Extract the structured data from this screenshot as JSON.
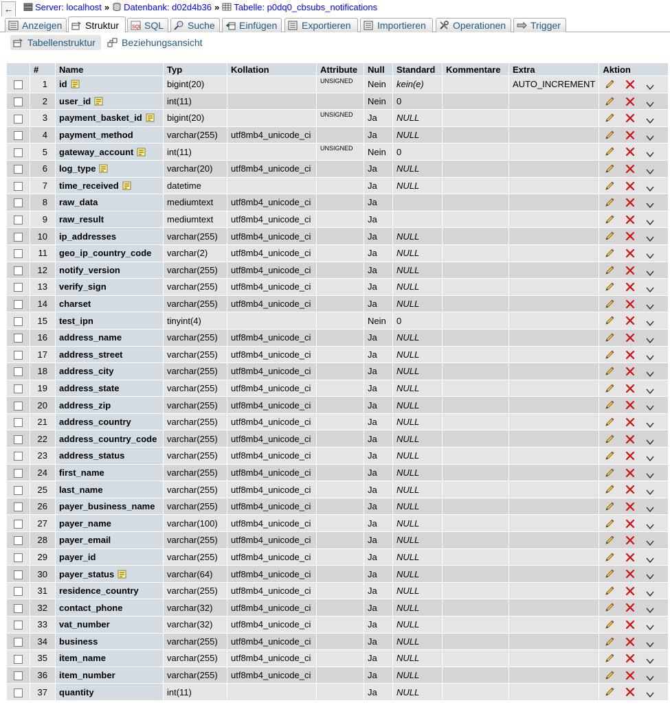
{
  "breadcrumb": {
    "server_label": "Server: localhost",
    "database_label": "Datenbank: d02d4b36",
    "table_label": "Tabelle: p0dq0_cbsubs_notifications",
    "separator": "»"
  },
  "back_symbol": "←",
  "tabs": [
    {
      "label": "Anzeigen",
      "icon": "browse-icon",
      "active": false
    },
    {
      "label": "Struktur",
      "icon": "structure-icon",
      "active": true
    },
    {
      "label": "SQL",
      "icon": "sql-icon",
      "active": false
    },
    {
      "label": "Suche",
      "icon": "search-icon",
      "active": false
    },
    {
      "label": "Einfügen",
      "icon": "insert-icon",
      "active": false
    },
    {
      "label": "Exportieren",
      "icon": "export-icon",
      "active": false
    },
    {
      "label": "Importieren",
      "icon": "import-icon",
      "active": false
    },
    {
      "label": "Operationen",
      "icon": "operations-icon",
      "active": false
    },
    {
      "label": "Trigger",
      "icon": "trigger-icon",
      "active": false
    }
  ],
  "subtabs": [
    {
      "label": "Tabellenstruktur",
      "icon": "table-structure-icon",
      "active": true
    },
    {
      "label": "Beziehungsansicht",
      "icon": "relation-view-icon",
      "active": false
    }
  ],
  "columns": [
    "#",
    "Name",
    "Typ",
    "Kollation",
    "Attribute",
    "Null",
    "Standard",
    "Kommentare",
    "Extra",
    "Aktion"
  ],
  "rows": [
    {
      "n": "1",
      "name": "id",
      "key": true,
      "type": "bigint(20)",
      "coll": "",
      "attr": "UNSIGNED",
      "null": "Nein",
      "def": "kein(e)",
      "defItalic": true,
      "extra": "AUTO_INCREMENT"
    },
    {
      "n": "2",
      "name": "user_id",
      "key": true,
      "type": "int(11)",
      "coll": "",
      "attr": "",
      "null": "Nein",
      "def": "0",
      "defItalic": false,
      "extra": ""
    },
    {
      "n": "3",
      "name": "payment_basket_id",
      "key": true,
      "type": "bigint(20)",
      "coll": "",
      "attr": "UNSIGNED",
      "null": "Ja",
      "def": "NULL",
      "defItalic": true,
      "extra": ""
    },
    {
      "n": "4",
      "name": "payment_method",
      "key": false,
      "type": "varchar(255)",
      "coll": "utf8mb4_unicode_ci",
      "attr": "",
      "null": "Ja",
      "def": "NULL",
      "defItalic": true,
      "extra": ""
    },
    {
      "n": "5",
      "name": "gateway_account",
      "key": true,
      "type": "int(11)",
      "coll": "",
      "attr": "UNSIGNED",
      "null": "Nein",
      "def": "0",
      "defItalic": false,
      "extra": ""
    },
    {
      "n": "6",
      "name": "log_type",
      "key": true,
      "type": "varchar(20)",
      "coll": "utf8mb4_unicode_ci",
      "attr": "",
      "null": "Ja",
      "def": "NULL",
      "defItalic": true,
      "extra": ""
    },
    {
      "n": "7",
      "name": "time_received",
      "key": true,
      "type": "datetime",
      "coll": "",
      "attr": "",
      "null": "Ja",
      "def": "NULL",
      "defItalic": true,
      "extra": ""
    },
    {
      "n": "8",
      "name": "raw_data",
      "key": false,
      "type": "mediumtext",
      "coll": "utf8mb4_unicode_ci",
      "attr": "",
      "null": "Ja",
      "def": "",
      "defItalic": false,
      "extra": ""
    },
    {
      "n": "9",
      "name": "raw_result",
      "key": false,
      "type": "mediumtext",
      "coll": "utf8mb4_unicode_ci",
      "attr": "",
      "null": "Ja",
      "def": "",
      "defItalic": false,
      "extra": ""
    },
    {
      "n": "10",
      "name": "ip_addresses",
      "key": false,
      "type": "varchar(255)",
      "coll": "utf8mb4_unicode_ci",
      "attr": "",
      "null": "Ja",
      "def": "NULL",
      "defItalic": true,
      "extra": ""
    },
    {
      "n": "11",
      "name": "geo_ip_country_code",
      "key": false,
      "type": "varchar(2)",
      "coll": "utf8mb4_unicode_ci",
      "attr": "",
      "null": "Ja",
      "def": "NULL",
      "defItalic": true,
      "extra": ""
    },
    {
      "n": "12",
      "name": "notify_version",
      "key": false,
      "type": "varchar(255)",
      "coll": "utf8mb4_unicode_ci",
      "attr": "",
      "null": "Ja",
      "def": "NULL",
      "defItalic": true,
      "extra": ""
    },
    {
      "n": "13",
      "name": "verify_sign",
      "key": false,
      "type": "varchar(255)",
      "coll": "utf8mb4_unicode_ci",
      "attr": "",
      "null": "Ja",
      "def": "NULL",
      "defItalic": true,
      "extra": ""
    },
    {
      "n": "14",
      "name": "charset",
      "key": false,
      "type": "varchar(255)",
      "coll": "utf8mb4_unicode_ci",
      "attr": "",
      "null": "Ja",
      "def": "NULL",
      "defItalic": true,
      "extra": ""
    },
    {
      "n": "15",
      "name": "test_ipn",
      "key": false,
      "type": "tinyint(4)",
      "coll": "",
      "attr": "",
      "null": "Nein",
      "def": "0",
      "defItalic": false,
      "extra": ""
    },
    {
      "n": "16",
      "name": "address_name",
      "key": false,
      "type": "varchar(255)",
      "coll": "utf8mb4_unicode_ci",
      "attr": "",
      "null": "Ja",
      "def": "NULL",
      "defItalic": true,
      "extra": ""
    },
    {
      "n": "17",
      "name": "address_street",
      "key": false,
      "type": "varchar(255)",
      "coll": "utf8mb4_unicode_ci",
      "attr": "",
      "null": "Ja",
      "def": "NULL",
      "defItalic": true,
      "extra": ""
    },
    {
      "n": "18",
      "name": "address_city",
      "key": false,
      "type": "varchar(255)",
      "coll": "utf8mb4_unicode_ci",
      "attr": "",
      "null": "Ja",
      "def": "NULL",
      "defItalic": true,
      "extra": ""
    },
    {
      "n": "19",
      "name": "address_state",
      "key": false,
      "type": "varchar(255)",
      "coll": "utf8mb4_unicode_ci",
      "attr": "",
      "null": "Ja",
      "def": "NULL",
      "defItalic": true,
      "extra": ""
    },
    {
      "n": "20",
      "name": "address_zip",
      "key": false,
      "type": "varchar(255)",
      "coll": "utf8mb4_unicode_ci",
      "attr": "",
      "null": "Ja",
      "def": "NULL",
      "defItalic": true,
      "extra": ""
    },
    {
      "n": "21",
      "name": "address_country",
      "key": false,
      "type": "varchar(255)",
      "coll": "utf8mb4_unicode_ci",
      "attr": "",
      "null": "Ja",
      "def": "NULL",
      "defItalic": true,
      "extra": ""
    },
    {
      "n": "22",
      "name": "address_country_code",
      "key": false,
      "type": "varchar(255)",
      "coll": "utf8mb4_unicode_ci",
      "attr": "",
      "null": "Ja",
      "def": "NULL",
      "defItalic": true,
      "extra": ""
    },
    {
      "n": "23",
      "name": "address_status",
      "key": false,
      "type": "varchar(255)",
      "coll": "utf8mb4_unicode_ci",
      "attr": "",
      "null": "Ja",
      "def": "NULL",
      "defItalic": true,
      "extra": ""
    },
    {
      "n": "24",
      "name": "first_name",
      "key": false,
      "type": "varchar(255)",
      "coll": "utf8mb4_unicode_ci",
      "attr": "",
      "null": "Ja",
      "def": "NULL",
      "defItalic": true,
      "extra": ""
    },
    {
      "n": "25",
      "name": "last_name",
      "key": false,
      "type": "varchar(255)",
      "coll": "utf8mb4_unicode_ci",
      "attr": "",
      "null": "Ja",
      "def": "NULL",
      "defItalic": true,
      "extra": ""
    },
    {
      "n": "26",
      "name": "payer_business_name",
      "key": false,
      "type": "varchar(255)",
      "coll": "utf8mb4_unicode_ci",
      "attr": "",
      "null": "Ja",
      "def": "NULL",
      "defItalic": true,
      "extra": ""
    },
    {
      "n": "27",
      "name": "payer_name",
      "key": false,
      "type": "varchar(100)",
      "coll": "utf8mb4_unicode_ci",
      "attr": "",
      "null": "Ja",
      "def": "NULL",
      "defItalic": true,
      "extra": ""
    },
    {
      "n": "28",
      "name": "payer_email",
      "key": false,
      "type": "varchar(255)",
      "coll": "utf8mb4_unicode_ci",
      "attr": "",
      "null": "Ja",
      "def": "NULL",
      "defItalic": true,
      "extra": ""
    },
    {
      "n": "29",
      "name": "payer_id",
      "key": false,
      "type": "varchar(255)",
      "coll": "utf8mb4_unicode_ci",
      "attr": "",
      "null": "Ja",
      "def": "NULL",
      "defItalic": true,
      "extra": ""
    },
    {
      "n": "30",
      "name": "payer_status",
      "key": true,
      "type": "varchar(64)",
      "coll": "utf8mb4_unicode_ci",
      "attr": "",
      "null": "Ja",
      "def": "NULL",
      "defItalic": true,
      "extra": ""
    },
    {
      "n": "31",
      "name": "residence_country",
      "key": false,
      "type": "varchar(255)",
      "coll": "utf8mb4_unicode_ci",
      "attr": "",
      "null": "Ja",
      "def": "NULL",
      "defItalic": true,
      "extra": ""
    },
    {
      "n": "32",
      "name": "contact_phone",
      "key": false,
      "type": "varchar(32)",
      "coll": "utf8mb4_unicode_ci",
      "attr": "",
      "null": "Ja",
      "def": "NULL",
      "defItalic": true,
      "extra": ""
    },
    {
      "n": "33",
      "name": "vat_number",
      "key": false,
      "type": "varchar(32)",
      "coll": "utf8mb4_unicode_ci",
      "attr": "",
      "null": "Ja",
      "def": "NULL",
      "defItalic": true,
      "extra": ""
    },
    {
      "n": "34",
      "name": "business",
      "key": false,
      "type": "varchar(255)",
      "coll": "utf8mb4_unicode_ci",
      "attr": "",
      "null": "Ja",
      "def": "NULL",
      "defItalic": true,
      "extra": ""
    },
    {
      "n": "35",
      "name": "item_name",
      "key": false,
      "type": "varchar(255)",
      "coll": "utf8mb4_unicode_ci",
      "attr": "",
      "null": "Ja",
      "def": "NULL",
      "defItalic": true,
      "extra": ""
    },
    {
      "n": "36",
      "name": "item_number",
      "key": false,
      "type": "varchar(255)",
      "coll": "utf8mb4_unicode_ci",
      "attr": "",
      "null": "Ja",
      "def": "NULL",
      "defItalic": true,
      "extra": ""
    },
    {
      "n": "37",
      "name": "quantity",
      "key": false,
      "type": "int(11)",
      "coll": "",
      "attr": "",
      "null": "Ja",
      "def": "NULL",
      "defItalic": true,
      "extra": ""
    }
  ],
  "colors": {
    "header_bg": "#d3dce3",
    "row_odd": "#e5e5e5",
    "row_even": "#d5d5d5",
    "link": "#235a81",
    "delete_red": "#d01010"
  }
}
